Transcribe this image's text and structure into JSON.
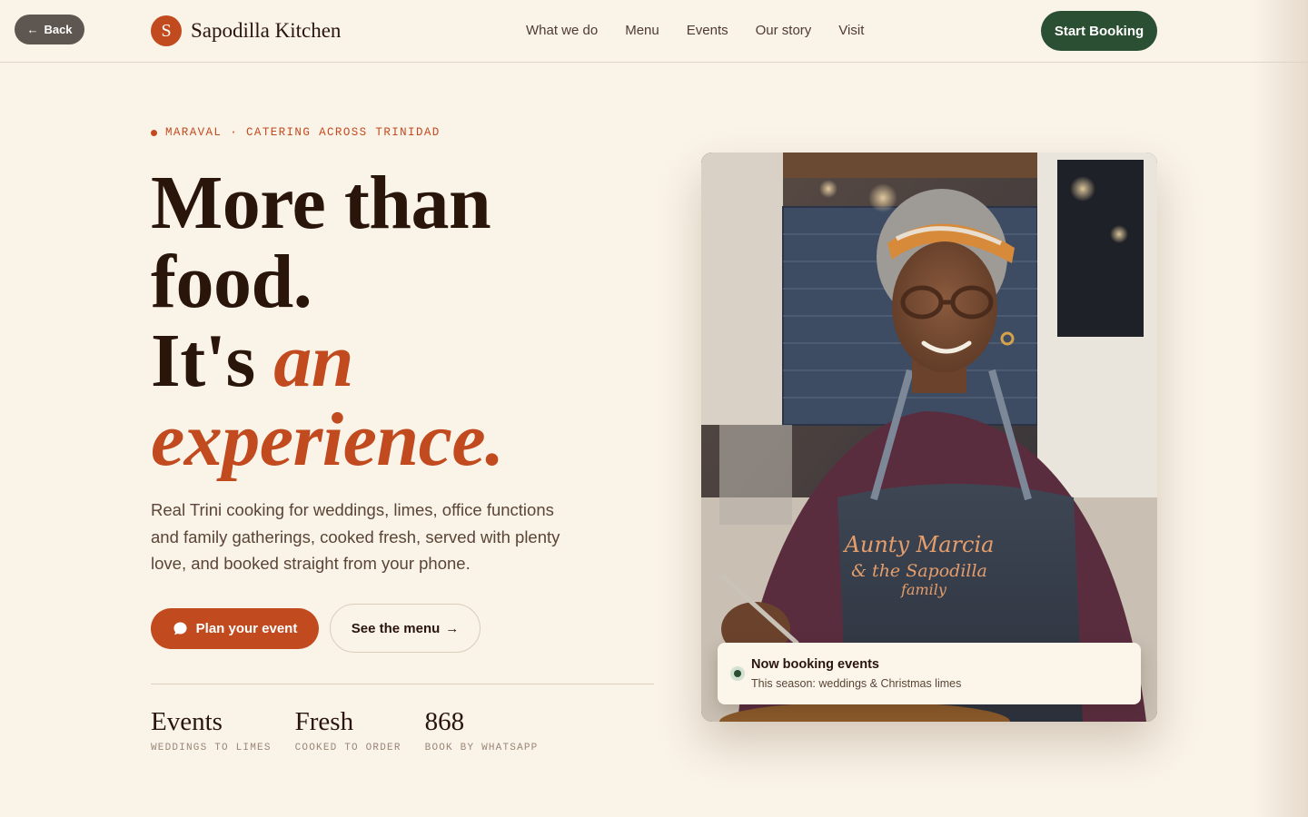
{
  "topbar": {
    "back_label": "Back",
    "brand_initial": "S",
    "brand_name": "Sapodilla Kitchen",
    "nav": [
      "What we do",
      "Menu",
      "Events",
      "Our story",
      "Visit"
    ],
    "start_booking_label": "Start Booking"
  },
  "hero": {
    "eyebrow": "MARAVAL · CATERING ACROSS TRINIDAD",
    "headline_line1": "More than",
    "headline_line2": "food.",
    "headline_line3_plain": "It's ",
    "headline_line3_accent": "an",
    "headline_line4_accent": "experience.",
    "lede": "Real Trini cooking for weddings, limes, office functions and family gatherings, cooked fresh, served with plenty love, and booked straight from your phone.",
    "cta_primary": "Plan your event",
    "cta_secondary": "See the menu",
    "cta_secondary_arrow": "→"
  },
  "stats": [
    {
      "value": "Events",
      "label": "WEDDINGS TO LIMES"
    },
    {
      "value": "Fresh",
      "label": "COOKED TO ORDER"
    },
    {
      "value": "868",
      "label": "BOOK BY WHATSAPP"
    }
  ],
  "photo": {
    "apron_line1": "Aunty Marcia",
    "apron_line2": "& the Sapodilla",
    "apron_line3": "family"
  },
  "status": {
    "title": "Now booking events",
    "subtitle": "This season: weddings & Christmas limes"
  },
  "colors": {
    "background": "#faf3e8",
    "accent": "#c14a1f",
    "green": "#2b4f33",
    "ink": "#2a150b"
  },
  "icons": [
    "arrow-left-icon",
    "chat-bubble-icon",
    "arrow-right-icon",
    "status-dot-icon"
  ]
}
